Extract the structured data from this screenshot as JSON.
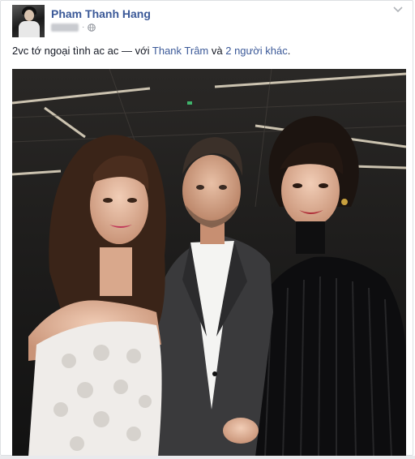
{
  "post": {
    "author": "Pham Thanh Hang",
    "text": "2vc tớ ngoại tình ac ac — với ",
    "tagged_person": "Thank Trâm",
    "connector": " và ",
    "others": "2 người khác",
    "end": "."
  },
  "icons": {
    "audience": "globe-icon",
    "menu": "chevron-down-icon"
  },
  "colors": {
    "link": "#3b5998",
    "text": "#141823",
    "meta": "#90949c"
  }
}
